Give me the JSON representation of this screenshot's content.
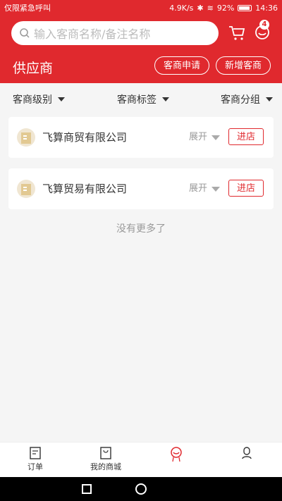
{
  "status_bar": {
    "carrier": "仅限紧急呼叫",
    "speed": "4.9K/s",
    "battery_pct": "92%",
    "battery_level": 0.92,
    "time": "14:36"
  },
  "header": {
    "search_placeholder": "输入客商名称/备注名称",
    "message_badge": "4",
    "title": "供应商",
    "apply_button": "客商申请",
    "add_button": "新增客商"
  },
  "filters": [
    {
      "label": "客商级别"
    },
    {
      "label": "客商标签"
    },
    {
      "label": "客商分组"
    }
  ],
  "suppliers": [
    {
      "name": "飞算商贸有限公司",
      "expand": "展开",
      "enter": "进店"
    },
    {
      "name": "飞算贸易有限公司",
      "expand": "展开",
      "enter": "进店"
    }
  ],
  "no_more_text": "没有更多了",
  "tabs": [
    {
      "label": "订单",
      "icon": "order-icon"
    },
    {
      "label": "我的商城",
      "icon": "shopping-bag-icon"
    },
    {
      "label": "",
      "icon": "supplier-icon"
    },
    {
      "label": "",
      "icon": "profile-icon"
    }
  ],
  "colors": {
    "accent": "#e0292e"
  }
}
